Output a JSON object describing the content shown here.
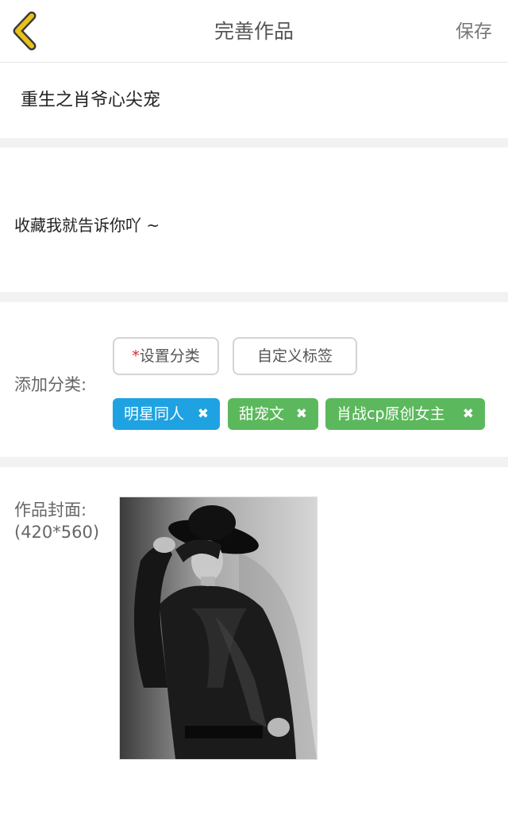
{
  "header": {
    "title": "完善作品",
    "save_label": "保存",
    "back_icon": "chevron-left-icon",
    "accent_color": "#e8c21a"
  },
  "work": {
    "title": "重生之肖爷心尖宠",
    "description": "收藏我就告诉你吖 ~"
  },
  "category": {
    "label": "添加分类:",
    "set_required_mark": "*",
    "set_label": "设置分类",
    "custom_tag_label": "自定义标签",
    "tags": [
      {
        "text": "明星同人",
        "remove": "✖",
        "color": "#1fa2e2"
      },
      {
        "text": "甜宠文",
        "remove": "✖",
        "color": "#5cb85c"
      },
      {
        "text": "肖战cp原创女主",
        "remove": "✖",
        "color": "#5cb85c"
      }
    ]
  },
  "cover": {
    "label_line1": "作品封面:",
    "label_line2": "(420*560)"
  }
}
